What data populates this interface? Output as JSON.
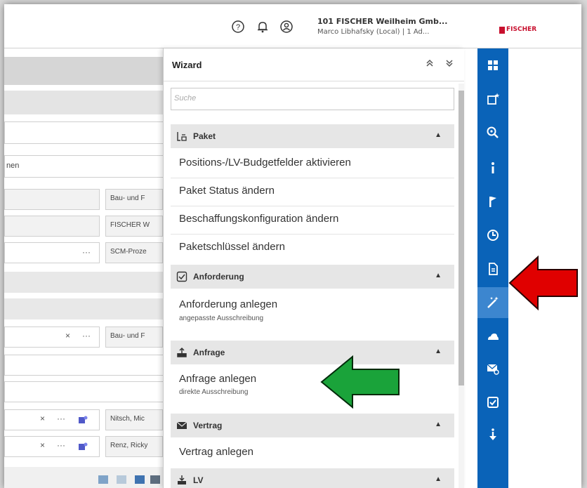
{
  "header": {
    "company": "101 FISCHER Weilheim Gmb...",
    "user": "Marco Libhafsky (Local) | 1 Ad...",
    "logo_text": "FISCHER",
    "icons": [
      "help-icon",
      "bell-icon",
      "user-icon"
    ]
  },
  "background_form": {
    "partial_label": "nen",
    "field_values": [
      "Bau- und F",
      "FISCHER W",
      "SCM-Proze",
      "Bau- und F",
      "Nitsch, Mic",
      "Renz, Ricky"
    ],
    "clear_symbol": "×",
    "more_symbol": "···"
  },
  "wizard": {
    "title": "Wizard",
    "collapse_all": "«",
    "expand_all": "»",
    "search_placeholder": "Suche",
    "sections": [
      {
        "label": "Paket",
        "icon": "package-icon",
        "items": [
          "Positions-/LV-Budgetfelder aktivieren",
          "Paket Status ändern",
          "Beschaffungskonfiguration ändern",
          "Paketschlüssel ändern"
        ]
      },
      {
        "label": "Anforderung",
        "icon": "checkbox-icon",
        "items": [
          {
            "title": "Anforderung anlegen",
            "subtitle": "angepasste Ausschreibung"
          }
        ]
      },
      {
        "label": "Anfrage",
        "icon": "upload-icon",
        "items": [
          {
            "title": "Anfrage anlegen",
            "subtitle": "direkte Ausschreibung"
          }
        ]
      },
      {
        "label": "Vertrag",
        "icon": "envelope-icon",
        "items": [
          "Vertrag anlegen"
        ]
      },
      {
        "label": "LV",
        "icon": "download-icon",
        "items": []
      }
    ]
  },
  "rail": {
    "icons": [
      "apps-icon",
      "new-window-icon",
      "search-zoom-icon",
      "info-icon",
      "flag-icon",
      "clock-icon",
      "document-icon",
      "wand-icon",
      "cloud-icon",
      "mail-settings-icon",
      "checkbox-icon",
      "download-arrow-icon"
    ],
    "active_index": 7,
    "color": "#0a63b8"
  },
  "annotations": {
    "red_arrow_color": "#e00000",
    "green_arrow_color": "#1aa33a"
  }
}
